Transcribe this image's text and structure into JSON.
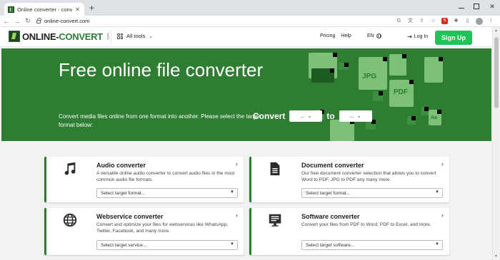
{
  "browser": {
    "tab_title": "Online converter - convert vide",
    "tab_close": "✕",
    "new_tab": "+",
    "url": "online-convert.com",
    "nav_back": "←",
    "nav_forward": "→",
    "nav_reload": "↻",
    "window_close": "✕",
    "extensions": [
      "G",
      "文",
      "⇧",
      "☆"
    ],
    "extension_badge": "↯",
    "puzzle": "✚",
    "sidebar_toggle": "▯",
    "menu": "⋮"
  },
  "header": {
    "logo_text_part1": "ONLINE-",
    "logo_text_part2": "CONVERT",
    "logo_suffix": ".COM",
    "all_tools": "All tools",
    "pricing": "Pricing",
    "help": "Help",
    "language": "EN",
    "login": "Log In",
    "login_arrow": "⇥",
    "signup": "Sign Up",
    "chevron": "⌄"
  },
  "hero": {
    "title": "Free online file converter",
    "subtitle": "Convert media files online from one format into another. Please select the target format below:",
    "convert_label": "Convert",
    "to_label": "to",
    "from_value": "...",
    "to_value": "...",
    "deco_labels": [
      "JPG",
      "PDF",
      "Aa"
    ]
  },
  "cards": [
    {
      "title": "Audio converter",
      "description": "A versatile online audio converter to convert audio files in the most common audio file formats.",
      "select_placeholder": "Select target format...",
      "icon": "music-note-icon"
    },
    {
      "title": "Document converter",
      "description": "Our free document converter selection that allows you to convert Word to PDF, JPG to PDF any many more.",
      "select_placeholder": "Select target format...",
      "icon": "document-icon"
    },
    {
      "title": "Webservice converter",
      "description": "Convert and optimize your files for webservices like WhatsApp, Twitter, Facebook, and many more.",
      "select_placeholder": "Select target service...",
      "icon": "globe-icon"
    },
    {
      "title": "Software converter",
      "description": "Convert your files from PDF to Word, PDF to Excel, and more.",
      "select_placeholder": "Select target software...",
      "icon": "monitor-icon"
    }
  ],
  "card_arrow": "›",
  "select_chevron": "▼",
  "colors": {
    "brand_green": "#2e7d32",
    "signup_green": "#22c25a",
    "hero_bg": "#2e7d32"
  }
}
